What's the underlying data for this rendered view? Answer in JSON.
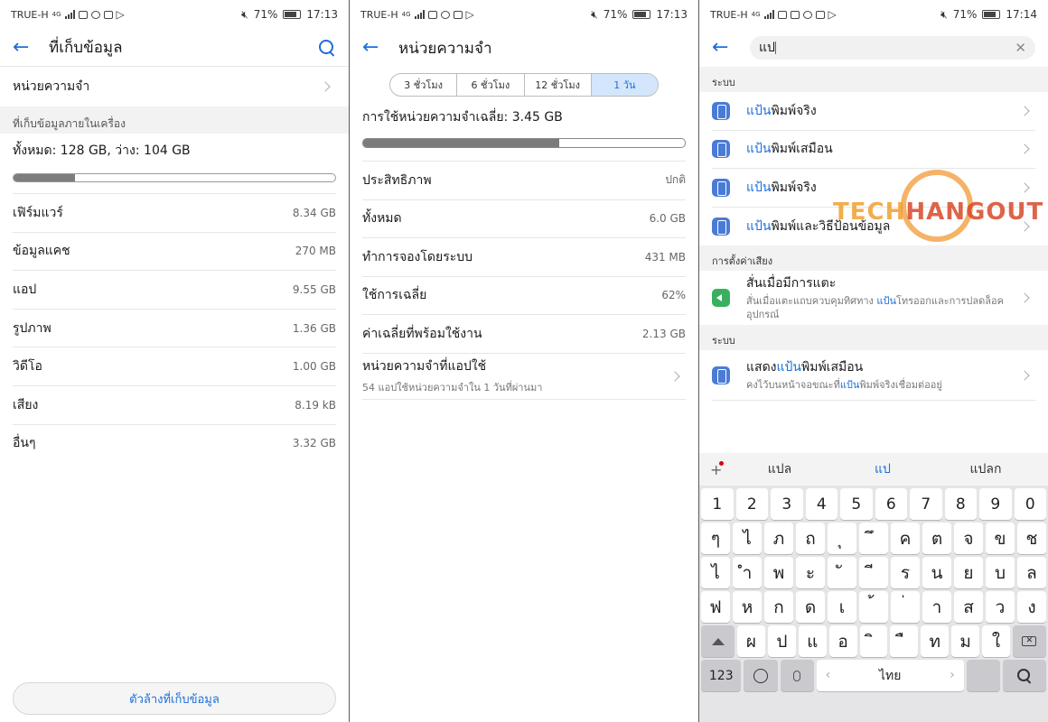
{
  "status": {
    "carrier": "TRUE-H",
    "network": "4G",
    "battery": "71%",
    "p1_time": "17:13",
    "p2_time": "17:13",
    "p3_time": "17:14"
  },
  "panel1": {
    "title": "ที่เก็บข้อมูล",
    "memory_link": "หน่วยความจำ",
    "section": "ที่เก็บข้อมูลภายในเครื่อง",
    "summary": "ทั้งหมด: 128 GB, ว่าง: 104 GB",
    "used_fraction": 0.19,
    "items": [
      {
        "label": "เฟิร์มแวร์",
        "value": "8.34 GB"
      },
      {
        "label": "ข้อมูลแคช",
        "value": "270 MB"
      },
      {
        "label": "แอป",
        "value": "9.55 GB"
      },
      {
        "label": "รูปภาพ",
        "value": "1.36 GB"
      },
      {
        "label": "วิดีโอ",
        "value": "1.00 GB"
      },
      {
        "label": "เสียง",
        "value": "8.19 kB"
      },
      {
        "label": "อื่นๆ",
        "value": "3.32 GB"
      }
    ],
    "clean_button": "ตัวล้างที่เก็บข้อมูล"
  },
  "panel2": {
    "title": "หน่วยความจำ",
    "tabs": [
      "3 ชั่วโมง",
      "6 ชั่วโมง",
      "12 ชั่วโมง",
      "1 วัน"
    ],
    "active_tab": 3,
    "avg_usage": "การใช้หน่วยความจำเฉลี่ย: 3.45 GB",
    "used_fraction": 0.61,
    "items": [
      {
        "label": "ประสิทธิภาพ",
        "value": "ปกติ"
      },
      {
        "label": "ทั้งหมด",
        "value": "6.0 GB"
      },
      {
        "label": "ทำการจองโดยระบบ",
        "value": "431 MB"
      },
      {
        "label": "ใช้การเฉลี่ย",
        "value": "62%"
      },
      {
        "label": "ค่าเฉลี่ยที่พร้อมใช้งาน",
        "value": "2.13 GB"
      }
    ],
    "apps_title": "หน่วยความจำที่แอปใช้",
    "apps_sub": "54 แอปใช้หน่วยความจำใน 1 วันที่ผ่านมา"
  },
  "panel3": {
    "search_value": "แป",
    "group1": "ระบบ",
    "results1": [
      {
        "hl": "แป้น",
        "rest": "พิมพ์จริง"
      },
      {
        "hl": "แป้น",
        "rest": "พิมพ์เสมือน"
      },
      {
        "hl": "แป้น",
        "rest": "พิมพ์จริง"
      },
      {
        "hl": "แป้น",
        "rest": "พิมพ์และวิธีป้อนข้อมูล"
      }
    ],
    "group2": "การตั้งค่าเสียง",
    "sound_title": "สั่นเมื่อมีการแตะ",
    "sound_sub_a": "สั่นเมื่อแตะแถบควบคุมทิศทาง ",
    "sound_sub_hl": "แป้น",
    "sound_sub_b": "โทรออกและการปลดล็อค อุปกรณ์",
    "group3": "ระบบ",
    "vk_a": "แสดง",
    "vk_hl": "แป้น",
    "vk_b": "พิมพ์เสมือน",
    "vk_sub_a": "คงไว้บนหน้าจอขณะที่",
    "vk_sub_hl": "แป้น",
    "vk_sub_b": "พิมพ์จริงเชื่อมต่ออยู่"
  },
  "keyboard": {
    "suggestions": [
      "แปล",
      "แป",
      "แปลก"
    ],
    "rows": [
      [
        "1",
        "2",
        "3",
        "4",
        "5",
        "6",
        "7",
        "8",
        "9",
        "0"
      ],
      [
        "ๆ",
        "ไ",
        "ำ",
        "พ",
        "ะ",
        "ั",
        "ี",
        "ร",
        "น",
        "ย",
        "บ",
        "ล"
      ],
      [
        "ฟ",
        "ห",
        "ก",
        "ด",
        "เ",
        "้",
        "่",
        "า",
        "ส",
        "ว",
        "ง"
      ],
      [
        "ผ",
        "ป",
        "แ",
        "อ",
        "ิ",
        "ื",
        "ท",
        "ม",
        "ใ"
      ]
    ],
    "row2": [
      "ๆ",
      "ไ",
      "ภ",
      "ถ",
      "ุ",
      "ึ",
      "ค",
      "ต",
      "จ",
      "ข",
      "ช"
    ],
    "row3": [
      "ไ",
      "ำ",
      "พ",
      "ะ",
      "ั",
      "ี",
      "ร",
      "น",
      "ย",
      "บ",
      "ล"
    ],
    "row4": [
      "ฟ",
      "ห",
      "ก",
      "ด",
      "เ",
      "้",
      "่",
      "า",
      "ส",
      "ว",
      "ง"
    ],
    "row5": [
      "ผ",
      "ป",
      "แ",
      "อ",
      "ิ",
      "ื",
      "ท",
      "ม",
      "ใ"
    ],
    "num_key": "123",
    "space_label": "ไทย"
  },
  "watermark": {
    "a": "TECH",
    "b": "HANGOUT"
  }
}
